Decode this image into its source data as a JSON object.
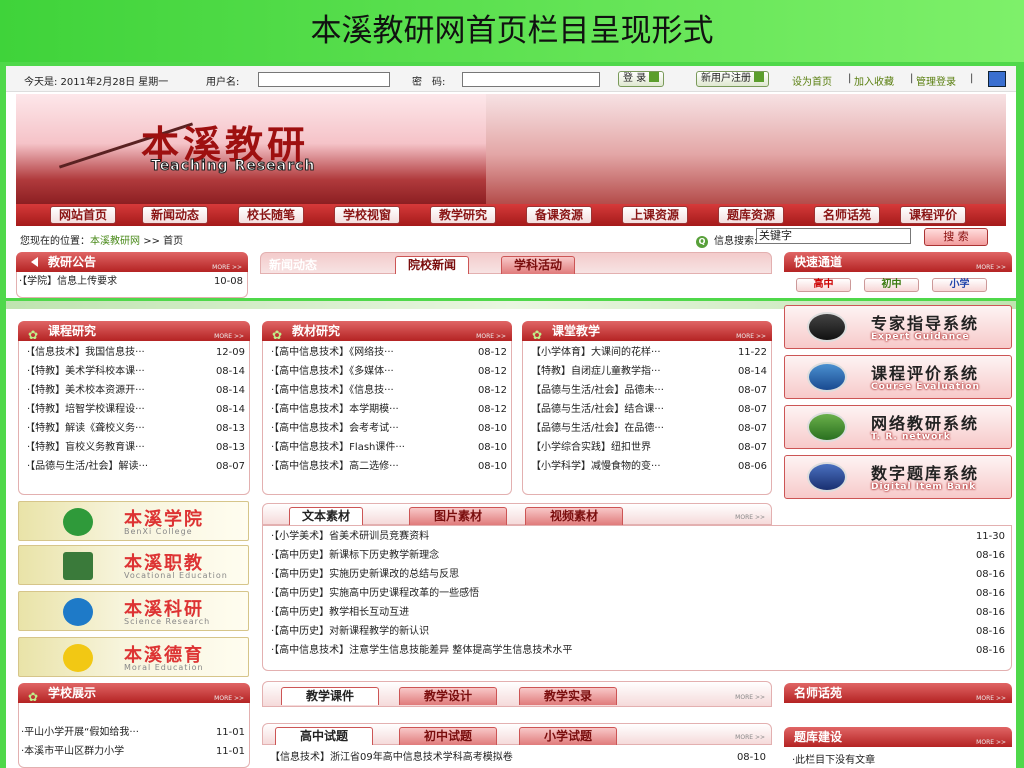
{
  "slide_title": "本溪教研网首页栏目呈现形式",
  "topbar": {
    "date_text": "今天是: 2011年2月28日 星期一",
    "username_label": "用户名:",
    "password_label": "密　码:",
    "login_label": "登 录",
    "register_label": "新用户注册",
    "links": [
      "设为首页",
      "加入收藏",
      "管理登录"
    ]
  },
  "banner": {
    "title_cn": "本溪教研",
    "title_en": "Teaching Research"
  },
  "nav": [
    "网站首页",
    "新闻动态",
    "校长随笔",
    "学校视窗",
    "教学研究",
    "备课资源",
    "上课资源",
    "题库资源",
    "名师话苑",
    "课程评价"
  ],
  "breadcrumb": {
    "prefix": "您现在的位置：",
    "site": "本溪教研网",
    "sep": ">>",
    "page": "首页"
  },
  "search": {
    "label": "信息搜索:",
    "value": "关键字",
    "button": "搜 索"
  },
  "notice": {
    "title": "教研公告",
    "more": "MORE >>",
    "items": [
      {
        "t": "·【学院】信息上传要求",
        "d": "10-08"
      }
    ]
  },
  "news": {
    "title": "新闻动态",
    "tabs": [
      "院校新闻",
      "学科活动"
    ]
  },
  "quick": {
    "title": "快速通道",
    "more": "MORE >>",
    "items": [
      "高中",
      "初中",
      "小学"
    ]
  },
  "course_research": {
    "title": "课程研究",
    "more": "MORE >>",
    "items": [
      {
        "t": "·【信息技术】我国信息技···",
        "d": "12-09"
      },
      {
        "t": "·【特教】美术学科校本课···",
        "d": "08-14"
      },
      {
        "t": "·【特教】美术校本资源开···",
        "d": "08-14"
      },
      {
        "t": "·【特教】培智学校课程设···",
        "d": "08-14"
      },
      {
        "t": "·【特教】解读《聋校义务···",
        "d": "08-13"
      },
      {
        "t": "·【特教】盲校义务教育课···",
        "d": "08-13"
      },
      {
        "t": "·【品德与生活/社会】解读···",
        "d": "08-07"
      }
    ]
  },
  "textbook_research": {
    "title": "教材研究",
    "more": "MORE >>",
    "items": [
      {
        "t": "·【高中信息技术】《网络技···",
        "d": "08-12"
      },
      {
        "t": "·【高中信息技术】《多媒体···",
        "d": "08-12"
      },
      {
        "t": "·【高中信息技术】《信息技···",
        "d": "08-12"
      },
      {
        "t": "·【高中信息技术】本学期模···",
        "d": "08-12"
      },
      {
        "t": "·【高中信息技术】会考考试···",
        "d": "08-10"
      },
      {
        "t": "·【高中信息技术】Flash课件···",
        "d": "08-10"
      },
      {
        "t": "·【高中信息技术】高二选修···",
        "d": "08-10"
      }
    ]
  },
  "class_teaching": {
    "title": "课堂教学",
    "more": "MORE >>",
    "items": [
      {
        "t": "【小学体育】大课间的花样···",
        "d": "11-22"
      },
      {
        "t": "【特教】自闭症儿童教学指···",
        "d": "08-14"
      },
      {
        "t": "【品德与生活/社会】品德未···",
        "d": "08-07"
      },
      {
        "t": "【品德与生活/社会】结合课···",
        "d": "08-07"
      },
      {
        "t": "【品德与生活/社会】在品德···",
        "d": "08-07"
      },
      {
        "t": "【小学综合实践】纽扣世界",
        "d": "08-07"
      },
      {
        "t": "【小学科学】减慢食物的变···",
        "d": "08-06"
      }
    ]
  },
  "systems": [
    {
      "cn": "专家指导系统",
      "en": "Expert Guidance"
    },
    {
      "cn": "课程评价系统",
      "en": "Course Evaluation"
    },
    {
      "cn": "网络教研系统",
      "en": "T. R. network"
    },
    {
      "cn": "数字题库系统",
      "en": "Digital Item Bank"
    }
  ],
  "colleges": [
    {
      "cn": "本溪学院",
      "en": "BenXi College"
    },
    {
      "cn": "本溪职教",
      "en": "Vocational Education"
    },
    {
      "cn": "本溪科研",
      "en": "Science Research"
    },
    {
      "cn": "本溪德育",
      "en": "Moral Education"
    }
  ],
  "materials": {
    "tabs": [
      "文本素材",
      "图片素材",
      "视频素材"
    ],
    "more": "MORE >>",
    "items": [
      {
        "t": "·【小学美术】省美术研训员竞赛资料",
        "d": "11-30"
      },
      {
        "t": "·【高中历史】新课标下历史教学新理念",
        "d": "08-16"
      },
      {
        "t": "·【高中历史】实施历史新课改的总结与反思",
        "d": "08-16"
      },
      {
        "t": "·【高中历史】实施高中历史课程改革的一些感悟",
        "d": "08-16"
      },
      {
        "t": "·【高中历史】教学相长互动互进",
        "d": "08-16"
      },
      {
        "t": "·【高中历史】对新课程教学的新认识",
        "d": "08-16"
      },
      {
        "t": "·【高中信息技术】注意学生信息技能差异 整体提高学生信息技术水平",
        "d": "08-16"
      }
    ]
  },
  "school_show": {
    "title": "学校展示",
    "more": "MORE >>",
    "items": [
      {
        "t": "·平山小学开展“假如给我···",
        "d": "11-01"
      },
      {
        "t": "·本溪市平山区群力小学",
        "d": "11-01"
      }
    ]
  },
  "courseware": {
    "tabs": [
      "教学课件",
      "教学设计",
      "教学实录"
    ],
    "more": "MORE >>"
  },
  "famous": {
    "title": "名师话苑",
    "more": "MORE >>"
  },
  "exams": {
    "tabs": [
      "高中试题",
      "初中试题",
      "小学试题"
    ],
    "more": "MORE >>",
    "items": [
      {
        "t": "【信息技术】浙江省09年高中信息技术学科高考模拟卷",
        "d": "08-10"
      }
    ]
  },
  "item_bank": {
    "title": "题库建设",
    "more": "MORE >>",
    "items": [
      "·此栏目下没有文章"
    ]
  }
}
